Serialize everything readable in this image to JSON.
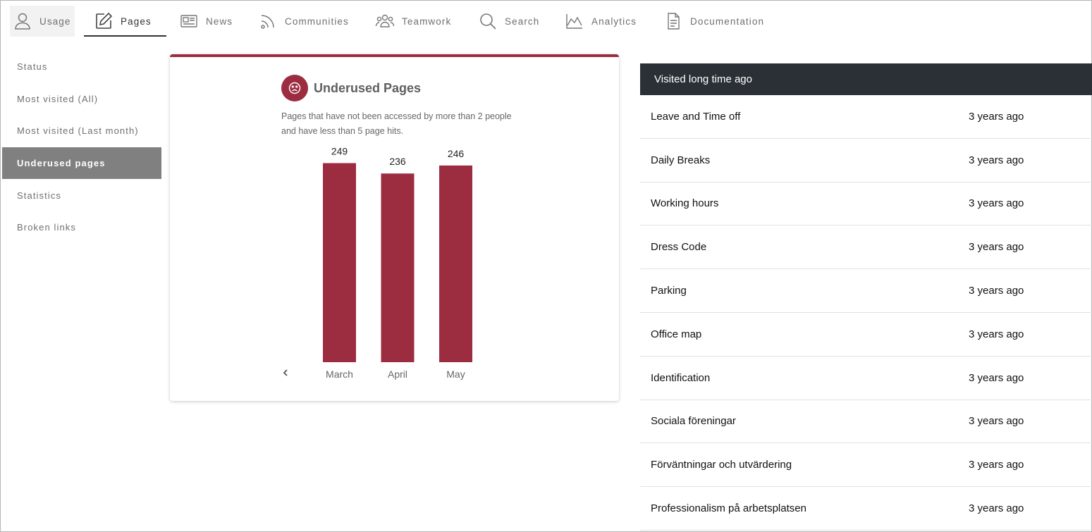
{
  "topnav": {
    "tabs": [
      {
        "label": "Usage",
        "icon": "user-icon"
      },
      {
        "label": "Pages",
        "icon": "edit-icon"
      },
      {
        "label": "News",
        "icon": "newspaper-icon"
      },
      {
        "label": "Communities",
        "icon": "rss-icon"
      },
      {
        "label": "Teamwork",
        "icon": "team-icon"
      },
      {
        "label": "Search",
        "icon": "search-icon"
      },
      {
        "label": "Analytics",
        "icon": "area-chart-icon"
      },
      {
        "label": "Documentation",
        "icon": "document-icon"
      }
    ],
    "active": "Pages"
  },
  "sidenav": {
    "items": [
      "Status",
      "Most visited (All)",
      "Most visited (Last month)",
      "Underused pages",
      "Statistics",
      "Broken links"
    ],
    "active": "Underused pages"
  },
  "card": {
    "title": "Underused Pages",
    "description": "Pages that have not been accessed by more than 2 people and have less than 5 page hits.",
    "icon": "sad-face-icon",
    "accent": "#9c2d41"
  },
  "chart_data": {
    "type": "bar",
    "categories": [
      "March",
      "April",
      "May"
    ],
    "values": [
      249,
      236,
      246
    ],
    "data_labels": [
      "249",
      "236",
      "246"
    ],
    "color": "#9c2d41",
    "ylim": [
      0,
      260
    ],
    "grid": false,
    "title": "",
    "xlabel": "",
    "ylabel": ""
  },
  "table": {
    "header": "Visited long time ago",
    "header_color": "#2b3036",
    "rows": [
      {
        "name": "Leave and Time off",
        "when": "3 years ago"
      },
      {
        "name": "Daily Breaks",
        "when": "3 years ago"
      },
      {
        "name": "Working hours",
        "when": "3 years ago"
      },
      {
        "name": "Dress Code",
        "when": "3 years ago"
      },
      {
        "name": "Parking",
        "when": "3 years ago"
      },
      {
        "name": "Office map",
        "when": "3 years ago"
      },
      {
        "name": "Identification",
        "when": "3 years ago"
      },
      {
        "name": "Sociala föreningar",
        "when": "3 years ago"
      },
      {
        "name": "Förväntningar och utvärdering",
        "when": "3 years ago"
      },
      {
        "name": "Professionalism på arbetsplatsen",
        "when": "3 years ago"
      }
    ]
  }
}
